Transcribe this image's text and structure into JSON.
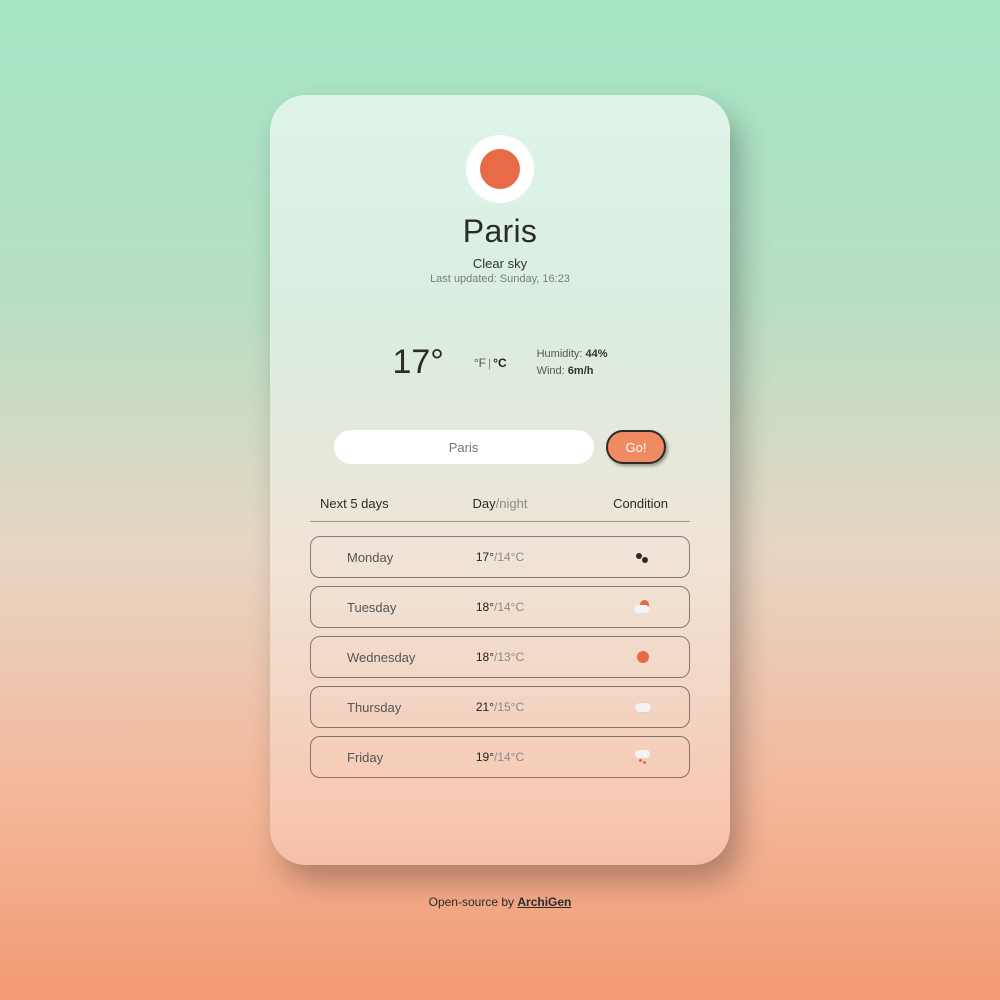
{
  "header": {
    "city": "Paris",
    "condition": "Clear sky",
    "updated_prefix": "Last updated: ",
    "updated_value": "Sunday, 16:23",
    "icon": "sun-icon"
  },
  "current": {
    "temp": "17°",
    "unit_f": "°F",
    "unit_c": "°C",
    "humidity_label": "Humidity: ",
    "humidity_value": "44%",
    "wind_label": "Wind: ",
    "wind_value": "6m/h"
  },
  "search": {
    "placeholder": "Paris",
    "go": "Go!"
  },
  "table": {
    "col1": "Next 5 days",
    "col2_day": "Day",
    "col2_sep": "/",
    "col2_night": "night",
    "col3": "Condition"
  },
  "forecast": [
    {
      "day": "Monday",
      "hi": "17°",
      "lo": "/14°C",
      "icon": "dark"
    },
    {
      "day": "Tuesday",
      "hi": "18°",
      "lo": "/14°C",
      "icon": "partly"
    },
    {
      "day": "Wednesday",
      "hi": "18°",
      "lo": "/13°C",
      "icon": "sunny"
    },
    {
      "day": "Thursday",
      "hi": "21°",
      "lo": "/15°C",
      "icon": "cloud"
    },
    {
      "day": "Friday",
      "hi": "19°",
      "lo": "/14°C",
      "icon": "rain"
    }
  ],
  "footer": {
    "text": "Open-source by",
    "link": " ArchiGen"
  }
}
